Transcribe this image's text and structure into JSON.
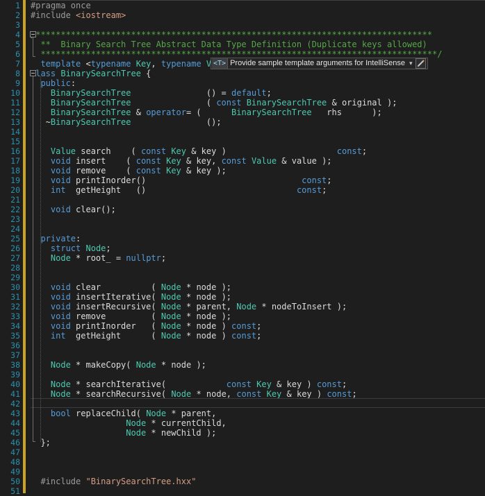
{
  "editor": {
    "language": "C++",
    "theme": "Visual Studio Dark",
    "colors": {
      "background": "#1e1e1e",
      "line_number": "#2b91af",
      "keyword": "#569cd6",
      "type": "#4ec9b0",
      "string": "#d69d85",
      "comment": "#57a64a",
      "plain_text": "#dcdcdc",
      "change_bar": "#c9a227",
      "current_line_border": "#3b3b3d"
    },
    "current_line": 42,
    "first_line": 1,
    "last_line": 51
  },
  "tooltip": {
    "badge": "<T>",
    "label": "Provide sample template arguments for IntelliSense",
    "dropdown_caret": "▾",
    "edit_icon": "pencil-icon"
  },
  "lines": [
    {
      "n": 1,
      "tokens": [
        {
          "t": "#pragma ",
          "c": "pp"
        },
        {
          "t": "once",
          "c": "pp"
        }
      ]
    },
    {
      "n": 2,
      "tokens": [
        {
          "t": "#include ",
          "c": "pp"
        },
        {
          "t": "<iostream>",
          "c": "str"
        }
      ]
    },
    {
      "n": 3,
      "tokens": []
    },
    {
      "n": 4,
      "tokens": [
        {
          "t": "/*******************************************************************************",
          "c": "cmt"
        }
      ]
    },
    {
      "n": 5,
      "tokens": [
        {
          "t": "  **  Binary Search Tree Abstract Data Type Definition (Duplicate keys allowed)",
          "c": "cmt"
        }
      ]
    },
    {
      "n": 6,
      "tokens": [
        {
          "t": "  *******************************************************************************/",
          "c": "cmt"
        }
      ]
    },
    {
      "n": 7,
      "tokens": [
        {
          "t": "  ",
          "c": "punc"
        },
        {
          "t": "template",
          "c": "kw"
        },
        {
          "t": " <",
          "c": "punc"
        },
        {
          "t": "typename",
          "c": "kw"
        },
        {
          "t": " ",
          "c": "punc"
        },
        {
          "t": "Key",
          "c": "typ"
        },
        {
          "t": ", ",
          "c": "punc"
        },
        {
          "t": "typename",
          "c": "kw"
        },
        {
          "t": " ",
          "c": "punc"
        },
        {
          "t": "Value",
          "c": "typ"
        },
        {
          "t": ">",
          "c": "punc"
        }
      ]
    },
    {
      "n": 8,
      "tokens": [
        {
          "t": "class",
          "c": "kw"
        },
        {
          "t": " ",
          "c": "punc"
        },
        {
          "t": "BinarySearchTree",
          "c": "typ"
        },
        {
          "t": " {",
          "c": "punc"
        }
      ]
    },
    {
      "n": 9,
      "tokens": [
        {
          "t": "  ",
          "c": "punc"
        },
        {
          "t": "public",
          "c": "kw"
        },
        {
          "t": ":",
          "c": "punc"
        }
      ]
    },
    {
      "n": 10,
      "tokens": [
        {
          "t": "    ",
          "c": "punc"
        },
        {
          "t": "BinarySearchTree",
          "c": "typ"
        },
        {
          "t": "               () = ",
          "c": "punc"
        },
        {
          "t": "default",
          "c": "kw"
        },
        {
          "t": ";",
          "c": "punc"
        }
      ]
    },
    {
      "n": 11,
      "tokens": [
        {
          "t": "    ",
          "c": "punc"
        },
        {
          "t": "BinarySearchTree",
          "c": "typ"
        },
        {
          "t": "               ( ",
          "c": "punc"
        },
        {
          "t": "const",
          "c": "kw"
        },
        {
          "t": " ",
          "c": "punc"
        },
        {
          "t": "BinarySearchTree",
          "c": "typ"
        },
        {
          "t": " & original );",
          "c": "punc"
        }
      ]
    },
    {
      "n": 12,
      "tokens": [
        {
          "t": "    ",
          "c": "punc"
        },
        {
          "t": "BinarySearchTree",
          "c": "typ"
        },
        {
          "t": " & ",
          "c": "punc"
        },
        {
          "t": "operator",
          "c": "kw"
        },
        {
          "t": "= (      ",
          "c": "punc"
        },
        {
          "t": "BinarySearchTree",
          "c": "typ"
        },
        {
          "t": "   rhs      );",
          "c": "punc"
        }
      ]
    },
    {
      "n": 13,
      "tokens": [
        {
          "t": "   ~",
          "c": "punc"
        },
        {
          "t": "BinarySearchTree",
          "c": "typ"
        },
        {
          "t": "               ();",
          "c": "punc"
        }
      ]
    },
    {
      "n": 14,
      "tokens": []
    },
    {
      "n": 15,
      "tokens": []
    },
    {
      "n": 16,
      "tokens": [
        {
          "t": "    ",
          "c": "punc"
        },
        {
          "t": "Value",
          "c": "typ"
        },
        {
          "t": " search    ( ",
          "c": "punc"
        },
        {
          "t": "const",
          "c": "kw"
        },
        {
          "t": " ",
          "c": "punc"
        },
        {
          "t": "Key",
          "c": "typ"
        },
        {
          "t": " & key )                      ",
          "c": "punc"
        },
        {
          "t": "const",
          "c": "kw"
        },
        {
          "t": ";",
          "c": "punc"
        }
      ]
    },
    {
      "n": 17,
      "tokens": [
        {
          "t": "    ",
          "c": "punc"
        },
        {
          "t": "void",
          "c": "kw"
        },
        {
          "t": " insert    ( ",
          "c": "punc"
        },
        {
          "t": "const",
          "c": "kw"
        },
        {
          "t": " ",
          "c": "punc"
        },
        {
          "t": "Key",
          "c": "typ"
        },
        {
          "t": " & key, ",
          "c": "punc"
        },
        {
          "t": "const",
          "c": "kw"
        },
        {
          "t": " ",
          "c": "punc"
        },
        {
          "t": "Value",
          "c": "typ"
        },
        {
          "t": " & value );",
          "c": "punc"
        }
      ]
    },
    {
      "n": 18,
      "tokens": [
        {
          "t": "    ",
          "c": "punc"
        },
        {
          "t": "void",
          "c": "kw"
        },
        {
          "t": " remove    ( ",
          "c": "punc"
        },
        {
          "t": "const",
          "c": "kw"
        },
        {
          "t": " ",
          "c": "punc"
        },
        {
          "t": "Key",
          "c": "typ"
        },
        {
          "t": " & key );",
          "c": "punc"
        }
      ]
    },
    {
      "n": 19,
      "tokens": [
        {
          "t": "    ",
          "c": "punc"
        },
        {
          "t": "void",
          "c": "kw"
        },
        {
          "t": " printInorder()                               ",
          "c": "punc"
        },
        {
          "t": "const",
          "c": "kw"
        },
        {
          "t": ";",
          "c": "punc"
        }
      ]
    },
    {
      "n": 20,
      "tokens": [
        {
          "t": "    ",
          "c": "punc"
        },
        {
          "t": "int",
          "c": "kw"
        },
        {
          "t": "  getHeight   ()                              ",
          "c": "punc"
        },
        {
          "t": "const",
          "c": "kw"
        },
        {
          "t": ";",
          "c": "punc"
        }
      ]
    },
    {
      "n": 21,
      "tokens": []
    },
    {
      "n": 22,
      "tokens": [
        {
          "t": "    ",
          "c": "punc"
        },
        {
          "t": "void",
          "c": "kw"
        },
        {
          "t": " clear();",
          "c": "punc"
        }
      ]
    },
    {
      "n": 23,
      "tokens": []
    },
    {
      "n": 24,
      "tokens": []
    },
    {
      "n": 25,
      "tokens": [
        {
          "t": "  ",
          "c": "punc"
        },
        {
          "t": "private",
          "c": "kw"
        },
        {
          "t": ":",
          "c": "punc"
        }
      ]
    },
    {
      "n": 26,
      "tokens": [
        {
          "t": "    ",
          "c": "punc"
        },
        {
          "t": "struct",
          "c": "kw"
        },
        {
          "t": " ",
          "c": "punc"
        },
        {
          "t": "Node",
          "c": "typ"
        },
        {
          "t": ";",
          "c": "punc"
        }
      ]
    },
    {
      "n": 27,
      "tokens": [
        {
          "t": "    ",
          "c": "punc"
        },
        {
          "t": "Node",
          "c": "typ"
        },
        {
          "t": " * root_ = ",
          "c": "punc"
        },
        {
          "t": "nullptr",
          "c": "kw"
        },
        {
          "t": ";",
          "c": "punc"
        }
      ]
    },
    {
      "n": 28,
      "tokens": []
    },
    {
      "n": 29,
      "tokens": []
    },
    {
      "n": 30,
      "tokens": [
        {
          "t": "    ",
          "c": "punc"
        },
        {
          "t": "void",
          "c": "kw"
        },
        {
          "t": " clear          ( ",
          "c": "punc"
        },
        {
          "t": "Node",
          "c": "typ"
        },
        {
          "t": " * node );",
          "c": "punc"
        }
      ]
    },
    {
      "n": 31,
      "tokens": [
        {
          "t": "    ",
          "c": "punc"
        },
        {
          "t": "void",
          "c": "kw"
        },
        {
          "t": " insertIterative( ",
          "c": "punc"
        },
        {
          "t": "Node",
          "c": "typ"
        },
        {
          "t": " * node );",
          "c": "punc"
        }
      ]
    },
    {
      "n": 32,
      "tokens": [
        {
          "t": "    ",
          "c": "punc"
        },
        {
          "t": "void",
          "c": "kw"
        },
        {
          "t": " insertRecursive( ",
          "c": "punc"
        },
        {
          "t": "Node",
          "c": "typ"
        },
        {
          "t": " * parent, ",
          "c": "punc"
        },
        {
          "t": "Node",
          "c": "typ"
        },
        {
          "t": " * nodeToInsert );",
          "c": "punc"
        }
      ]
    },
    {
      "n": 33,
      "tokens": [
        {
          "t": "    ",
          "c": "punc"
        },
        {
          "t": "void",
          "c": "kw"
        },
        {
          "t": " remove         ( ",
          "c": "punc"
        },
        {
          "t": "Node",
          "c": "typ"
        },
        {
          "t": " * node );",
          "c": "punc"
        }
      ]
    },
    {
      "n": 34,
      "tokens": [
        {
          "t": "    ",
          "c": "punc"
        },
        {
          "t": "void",
          "c": "kw"
        },
        {
          "t": " printInorder   ( ",
          "c": "punc"
        },
        {
          "t": "Node",
          "c": "typ"
        },
        {
          "t": " * node ) ",
          "c": "punc"
        },
        {
          "t": "const",
          "c": "kw"
        },
        {
          "t": ";",
          "c": "punc"
        }
      ]
    },
    {
      "n": 35,
      "tokens": [
        {
          "t": "    ",
          "c": "punc"
        },
        {
          "t": "int",
          "c": "kw"
        },
        {
          "t": "  getHeight      ( ",
          "c": "punc"
        },
        {
          "t": "Node",
          "c": "typ"
        },
        {
          "t": " * node ) ",
          "c": "punc"
        },
        {
          "t": "const",
          "c": "kw"
        },
        {
          "t": ";",
          "c": "punc"
        }
      ]
    },
    {
      "n": 36,
      "tokens": []
    },
    {
      "n": 37,
      "tokens": []
    },
    {
      "n": 38,
      "tokens": [
        {
          "t": "    ",
          "c": "punc"
        },
        {
          "t": "Node",
          "c": "typ"
        },
        {
          "t": " * makeCopy( ",
          "c": "punc"
        },
        {
          "t": "Node",
          "c": "typ"
        },
        {
          "t": " * node );",
          "c": "punc"
        }
      ]
    },
    {
      "n": 39,
      "tokens": []
    },
    {
      "n": 40,
      "tokens": [
        {
          "t": "    ",
          "c": "punc"
        },
        {
          "t": "Node",
          "c": "typ"
        },
        {
          "t": " * searchIterative(            ",
          "c": "punc"
        },
        {
          "t": "const",
          "c": "kw"
        },
        {
          "t": " ",
          "c": "punc"
        },
        {
          "t": "Key",
          "c": "typ"
        },
        {
          "t": " & key ) ",
          "c": "punc"
        },
        {
          "t": "const",
          "c": "kw"
        },
        {
          "t": ";",
          "c": "punc"
        }
      ]
    },
    {
      "n": 41,
      "tokens": [
        {
          "t": "    ",
          "c": "punc"
        },
        {
          "t": "Node",
          "c": "typ"
        },
        {
          "t": " * searchRecursive( ",
          "c": "punc"
        },
        {
          "t": "Node",
          "c": "typ"
        },
        {
          "t": " * node, ",
          "c": "punc"
        },
        {
          "t": "const",
          "c": "kw"
        },
        {
          "t": " ",
          "c": "punc"
        },
        {
          "t": "Key",
          "c": "typ"
        },
        {
          "t": " & key ) ",
          "c": "punc"
        },
        {
          "t": "const",
          "c": "kw"
        },
        {
          "t": ";",
          "c": "punc"
        }
      ]
    },
    {
      "n": 42,
      "tokens": []
    },
    {
      "n": 43,
      "tokens": [
        {
          "t": "    ",
          "c": "punc"
        },
        {
          "t": "bool",
          "c": "kw"
        },
        {
          "t": " replaceChild( ",
          "c": "punc"
        },
        {
          "t": "Node",
          "c": "typ"
        },
        {
          "t": " * parent,",
          "c": "punc"
        }
      ]
    },
    {
      "n": 44,
      "tokens": [
        {
          "t": "                   ",
          "c": "punc"
        },
        {
          "t": "Node",
          "c": "typ"
        },
        {
          "t": " * currentChild,",
          "c": "punc"
        }
      ]
    },
    {
      "n": 45,
      "tokens": [
        {
          "t": "                   ",
          "c": "punc"
        },
        {
          "t": "Node",
          "c": "typ"
        },
        {
          "t": " * newChild );",
          "c": "punc"
        }
      ]
    },
    {
      "n": 46,
      "tokens": [
        {
          "t": "  };",
          "c": "punc"
        }
      ]
    },
    {
      "n": 47,
      "tokens": []
    },
    {
      "n": 48,
      "tokens": []
    },
    {
      "n": 49,
      "tokens": []
    },
    {
      "n": 50,
      "tokens": [
        {
          "t": "  #include ",
          "c": "pp"
        },
        {
          "t": "\"BinarySearchTree.hxx\"",
          "c": "str"
        }
      ]
    },
    {
      "n": 51,
      "tokens": []
    }
  ]
}
